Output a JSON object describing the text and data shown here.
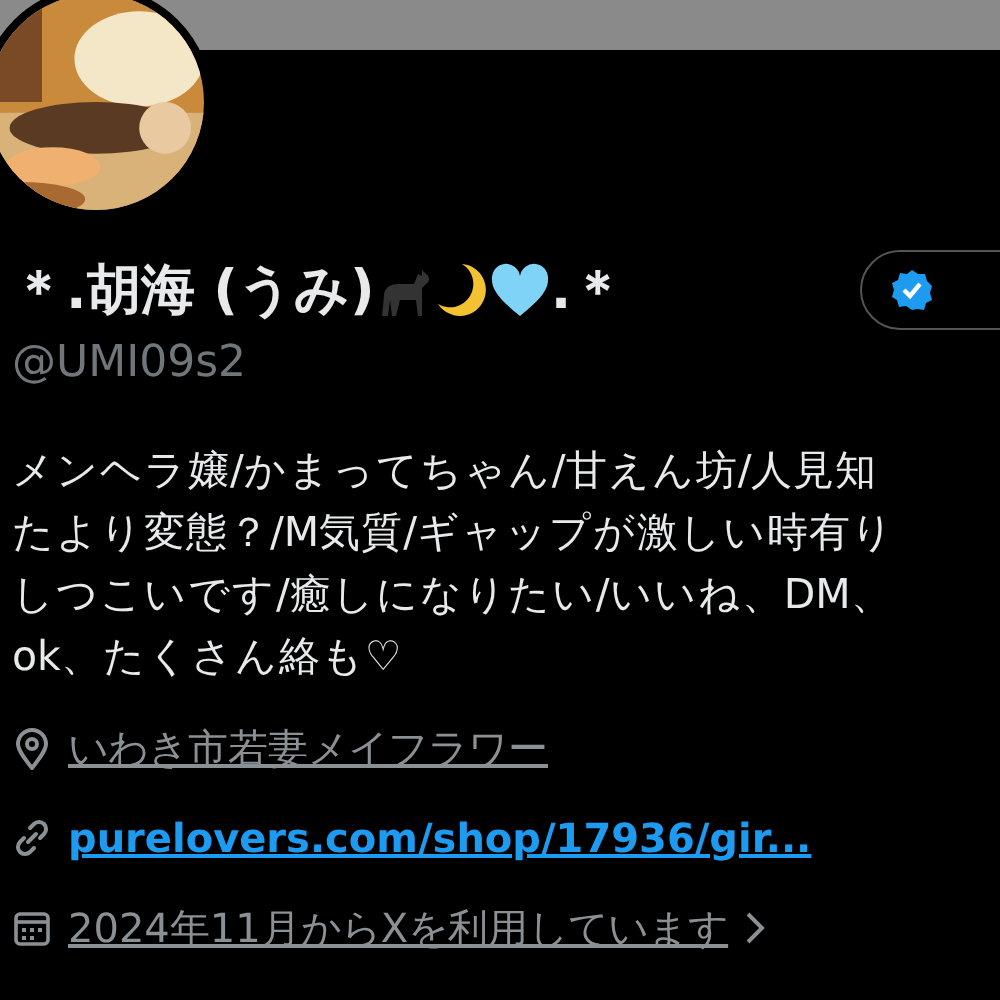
{
  "profile": {
    "name_prefix": "＊.胡海 (うみ)",
    "name_suffix": ".＊",
    "handle": "@UMI09s2",
    "verify_button": {
      "verified": true
    }
  },
  "bio_lines": [
    "メンヘラ嬢/かまってちゃん/甘えん坊/人見知",
    "たより変態？/M気質/ギャップが激しい時有り",
    "しつこいです/癒しになりたい/いいね、DM、",
    "ok、たくさん絡も♡"
  ],
  "details": [
    {
      "kind": "location",
      "text": "いわき市若妻メイフラワー"
    },
    {
      "kind": "link",
      "text": "purelovers.com/shop/17936/gir..."
    },
    {
      "kind": "joined",
      "text": "2024年11月からXを利用しています"
    }
  ]
}
